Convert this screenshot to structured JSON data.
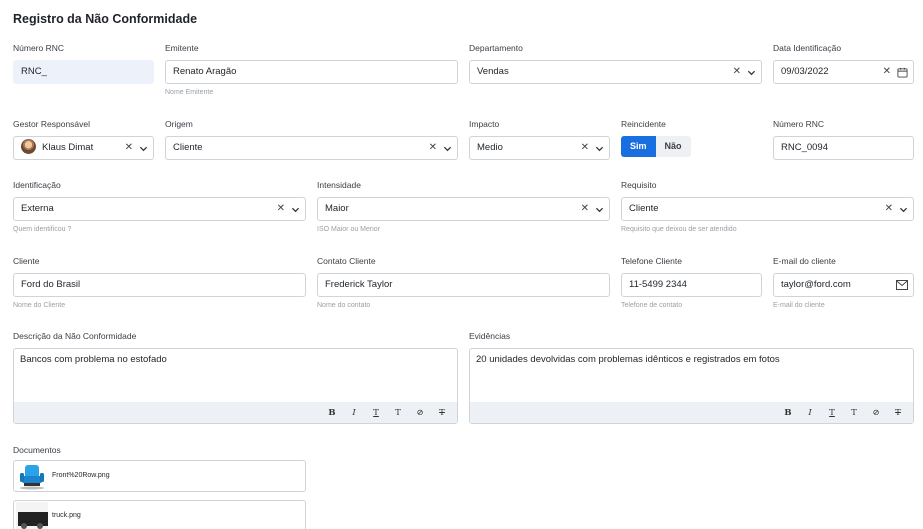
{
  "page": {
    "title": "Registro da Não Conformidade"
  },
  "row1": {
    "numero_rnc": {
      "label": "Número RNC",
      "value": "RNC_"
    },
    "emitente": {
      "label": "Emitente",
      "value": "Renato Aragão",
      "hint": "Nome Emitente"
    },
    "departamento": {
      "label": "Departamento",
      "value": "Vendas"
    },
    "data_identificacao": {
      "label": "Data Identificação",
      "value": "09/03/2022"
    }
  },
  "row2": {
    "gestor": {
      "label": "Gestor Responsável",
      "value": "Klaus Dimat"
    },
    "origem": {
      "label": "Origem",
      "value": "Cliente"
    },
    "impacto": {
      "label": "Impacto",
      "value": "Medio"
    },
    "reincidente": {
      "label": "Reincidente",
      "yes": "Sim",
      "no": "Não",
      "selected": "Sim"
    },
    "numero_rnc2": {
      "label": "Número RNC",
      "value": "RNC_0094"
    }
  },
  "row3": {
    "identificacao": {
      "label": "Identificação",
      "value": "Externa",
      "hint": "Quem identificou ?"
    },
    "intensidade": {
      "label": "Intensidade",
      "value": "Maior",
      "hint": "ISO Maior ou Menor"
    },
    "requisito": {
      "label": "Requisito",
      "value": "Cliente",
      "hint": "Requisito que deixou de ser atendido"
    }
  },
  "row4": {
    "cliente": {
      "label": "Cliente",
      "value": "Ford do Brasil",
      "hint": "Nome do Cliente"
    },
    "contato": {
      "label": "Contato Cliente",
      "value": "Frederick Taylor",
      "hint": "Nome do contato"
    },
    "telefone": {
      "label": "Telefone Cliente",
      "value": "11-5499 2344",
      "hint": "Telefone de contato"
    },
    "email": {
      "label": "E-mail do cliente",
      "value": "taylor@ford.com",
      "hint": "E-mail do cliente"
    }
  },
  "descricao": {
    "label": "Descrição da Não Conformidade",
    "value": "Bancos com problema no estofado"
  },
  "evidencias": {
    "label": "Evidências",
    "value": "20 unidades devolvidas com problemas idênticos e registrados em fotos"
  },
  "toolbar": {
    "bold": "B",
    "italic": "I",
    "clear_format": "T",
    "superscript": "T",
    "link": "⊘",
    "strike": "T"
  },
  "documentos": {
    "label": "Documentos",
    "files": [
      {
        "name": "Front%20Row.png"
      },
      {
        "name": "truck.png"
      }
    ]
  },
  "colors": {
    "accent": "#1a6fe0",
    "readonly_bg": "#edf2fa",
    "border": "#cfd4da"
  }
}
